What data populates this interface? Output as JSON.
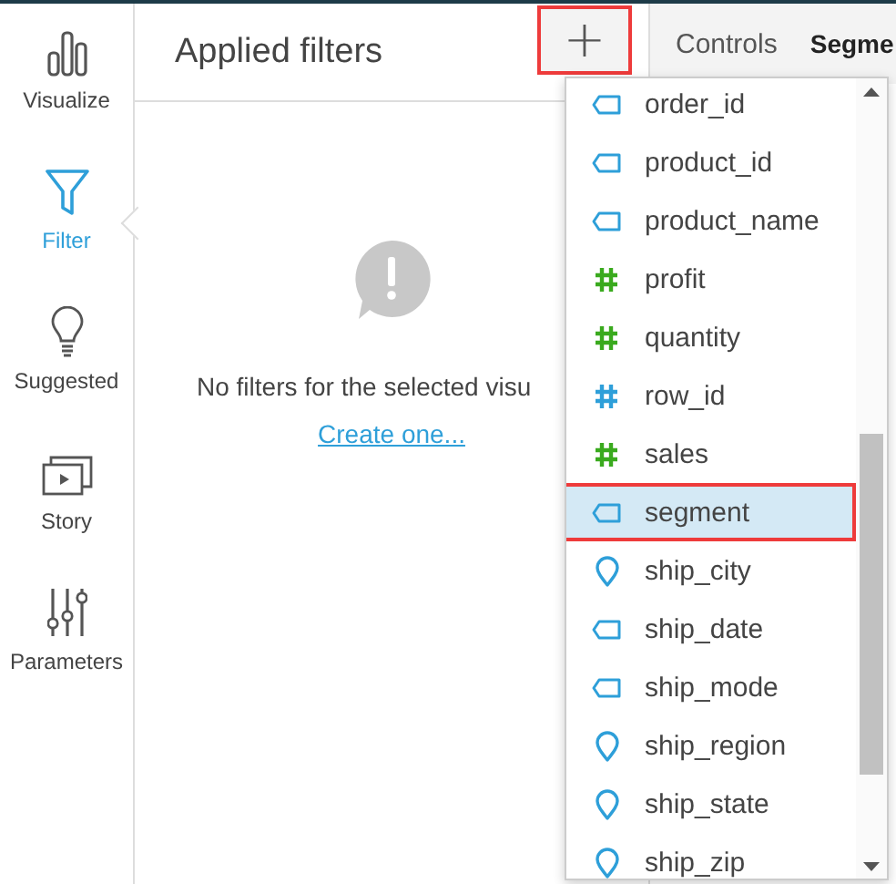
{
  "sidebar": {
    "items": [
      {
        "label": "Visualize",
        "kind": "bars",
        "selected": false
      },
      {
        "label": "Filter",
        "kind": "funnel",
        "selected": true
      },
      {
        "label": "Suggested",
        "kind": "bulb",
        "selected": false
      },
      {
        "label": "Story",
        "kind": "story",
        "selected": false
      },
      {
        "label": "Parameters",
        "kind": "sliders",
        "selected": false
      }
    ]
  },
  "filter_panel": {
    "title": "Applied filters",
    "add_button": {
      "label": "+",
      "highlighted": true
    },
    "empty_message": "No filters for the selected visu",
    "create_link": "Create one..."
  },
  "tabs": [
    {
      "label": "Controls",
      "selected": false
    },
    {
      "label": "Segme",
      "selected": true
    }
  ],
  "field_menu": {
    "items": [
      {
        "label": "order_id",
        "kind": "dimension",
        "color": "#2e9fd9",
        "selected": false
      },
      {
        "label": "product_id",
        "kind": "dimension",
        "color": "#2e9fd9",
        "selected": false
      },
      {
        "label": "product_name",
        "kind": "dimension",
        "color": "#2e9fd9",
        "selected": false
      },
      {
        "label": "profit",
        "kind": "measure",
        "color": "#3aaa1e",
        "selected": false
      },
      {
        "label": "quantity",
        "kind": "measure",
        "color": "#3aaa1e",
        "selected": false
      },
      {
        "label": "row_id",
        "kind": "measure",
        "color": "#2e9fd9",
        "selected": false
      },
      {
        "label": "sales",
        "kind": "measure",
        "color": "#3aaa1e",
        "selected": false
      },
      {
        "label": "segment",
        "kind": "dimension",
        "color": "#2e9fd9",
        "selected": true
      },
      {
        "label": "ship_city",
        "kind": "geo",
        "color": "#2e9fd9",
        "selected": false
      },
      {
        "label": "ship_date",
        "kind": "dimension",
        "color": "#2e9fd9",
        "selected": false
      },
      {
        "label": "ship_mode",
        "kind": "dimension",
        "color": "#2e9fd9",
        "selected": false
      },
      {
        "label": "ship_region",
        "kind": "geo",
        "color": "#2e9fd9",
        "selected": false
      },
      {
        "label": "ship_state",
        "kind": "geo",
        "color": "#2e9fd9",
        "selected": false
      },
      {
        "label": "ship_zip",
        "kind": "geo",
        "color": "#2e9fd9",
        "selected": false
      }
    ]
  }
}
